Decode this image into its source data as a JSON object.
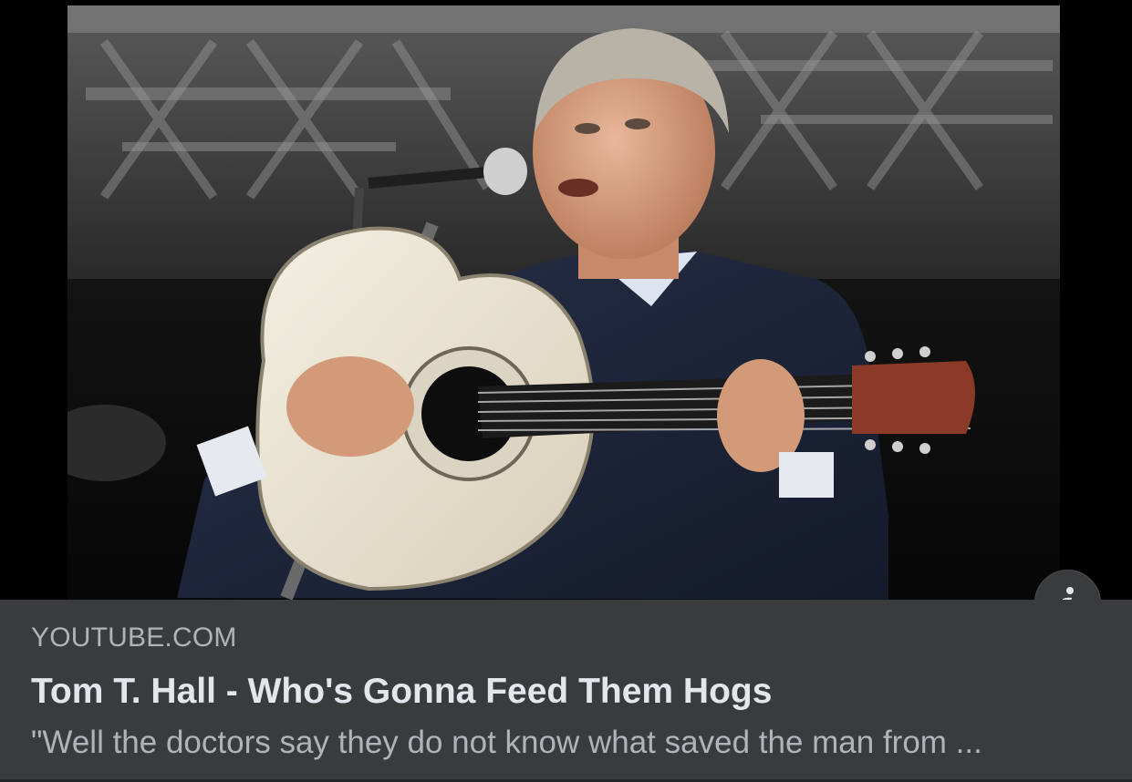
{
  "link_preview": {
    "domain": "YOUTUBE.COM",
    "title": "Tom T. Hall - Who's Gonna Feed Them Hogs",
    "description": "\"Well the doctors say they do not know what saved the man from ..."
  },
  "icons": {
    "info_button": "info-icon"
  },
  "colors": {
    "card_background": "#3a3b3c",
    "domain_text": "#b0b3b8",
    "title_text": "#e4e6eb",
    "description_text": "#b0b3b8",
    "info_button_background": "#3a3b3c"
  }
}
